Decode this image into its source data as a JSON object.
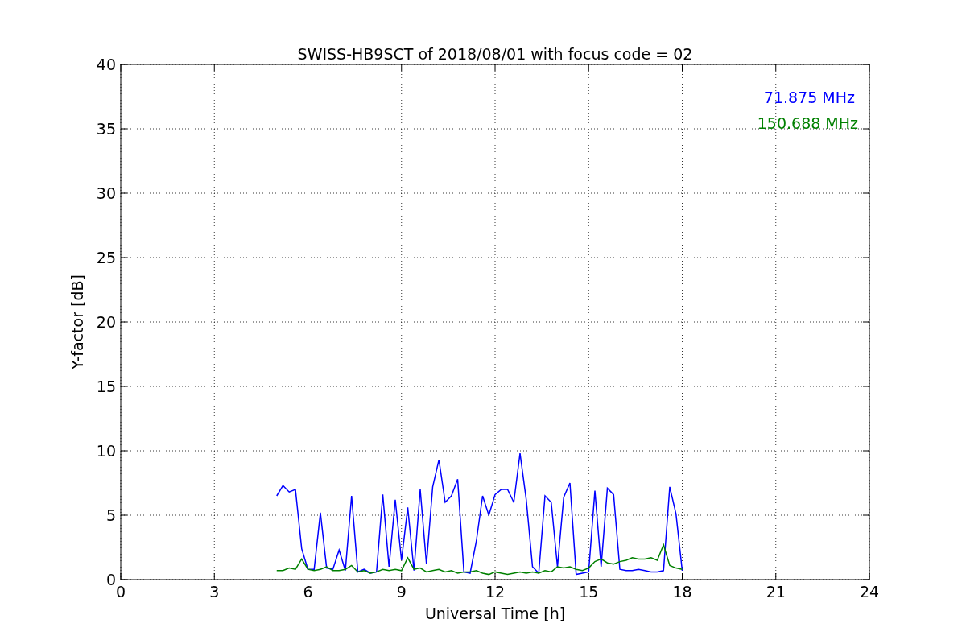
{
  "figure": {
    "chart_data": {
      "type": "line",
      "title": "SWISS-HB9SCT of 2018/08/01 with focus code = 02",
      "xlabel": "Universal Time [h]",
      "ylabel": "Y-factor [dB]",
      "x": [
        5.0,
        5.2,
        5.4,
        5.6,
        5.8,
        6.0,
        6.2,
        6.4,
        6.6,
        6.8,
        7.0,
        7.2,
        7.4,
        7.6,
        7.8,
        8.0,
        8.2,
        8.4,
        8.6,
        8.8,
        9.0,
        9.2,
        9.4,
        9.6,
        9.8,
        10.0,
        10.2,
        10.4,
        10.6,
        10.8,
        11.0,
        11.2,
        11.4,
        11.6,
        11.8,
        12.0,
        12.2,
        12.4,
        12.6,
        12.8,
        13.0,
        13.2,
        13.4,
        13.6,
        13.8,
        14.0,
        14.2,
        14.4,
        14.6,
        14.8,
        15.0,
        15.2,
        15.4,
        15.6,
        15.8,
        16.0,
        16.2,
        16.4,
        16.6,
        16.8,
        17.0,
        17.2,
        17.4,
        17.6,
        17.8,
        18.0
      ],
      "series": [
        {
          "name": "71.875 MHz",
          "color": "#0000ff",
          "values": [
            6.5,
            7.3,
            6.8,
            7.0,
            2.4,
            0.8,
            0.8,
            5.2,
            0.9,
            0.8,
            2.3,
            0.7,
            6.5,
            0.6,
            0.8,
            0.5,
            0.6,
            6.6,
            1.0,
            6.2,
            1.5,
            5.6,
            0.7,
            7.0,
            1.2,
            7.2,
            9.3,
            6.0,
            6.5,
            7.8,
            0.6,
            0.5,
            3.0,
            6.5,
            5.0,
            6.6,
            7.0,
            7.0,
            6.0,
            9.8,
            6.2,
            1.0,
            0.5,
            6.5,
            6.0,
            1.0,
            6.4,
            7.5,
            0.4,
            0.5,
            0.6,
            6.9,
            1.0,
            7.1,
            6.6,
            0.8,
            0.7,
            0.7,
            0.8,
            0.7,
            0.6,
            0.6,
            0.7,
            7.2,
            5.1,
            0.7
          ]
        },
        {
          "name": "150.688 MHz",
          "color": "#008000",
          "values": [
            0.7,
            0.7,
            0.9,
            0.8,
            1.6,
            0.8,
            0.7,
            0.8,
            1.0,
            0.7,
            0.7,
            0.8,
            1.1,
            0.6,
            0.7,
            0.5,
            0.6,
            0.8,
            0.7,
            0.8,
            0.7,
            1.7,
            0.8,
            0.9,
            0.6,
            0.7,
            0.8,
            0.6,
            0.7,
            0.5,
            0.6,
            0.6,
            0.7,
            0.5,
            0.4,
            0.6,
            0.5,
            0.4,
            0.5,
            0.6,
            0.5,
            0.6,
            0.5,
            0.7,
            0.6,
            1.0,
            0.9,
            1.0,
            0.8,
            0.7,
            0.9,
            1.4,
            1.6,
            1.3,
            1.2,
            1.4,
            1.5,
            1.7,
            1.6,
            1.6,
            1.7,
            1.5,
            2.7,
            1.1,
            0.9,
            0.8
          ]
        }
      ],
      "xlim": [
        0,
        24
      ],
      "ylim": [
        0,
        40
      ],
      "xticks": [
        0,
        3,
        6,
        9,
        12,
        15,
        18,
        21,
        24
      ],
      "yticks": [
        0,
        5,
        10,
        15,
        20,
        25,
        30,
        35,
        40
      ],
      "grid": true
    }
  }
}
